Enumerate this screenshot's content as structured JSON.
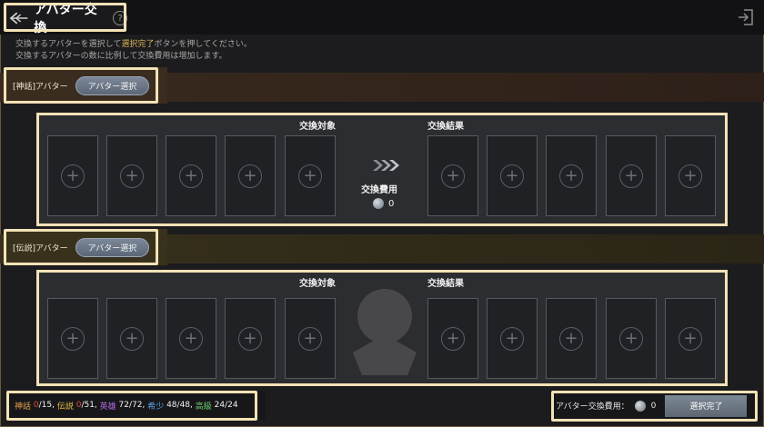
{
  "header": {
    "title": "アバター交換",
    "help": "?"
  },
  "info": {
    "line1_pre": "交換するアバターを選択して",
    "line1_highlight": "選択完了",
    "line1_post": "ボタンを押してください。",
    "line2": "交換するアバターの数に比例して交換費用は増加します。"
  },
  "sections": [
    {
      "label": "[神話]アバター",
      "select_button": "アバター選択",
      "target_title": "交換対象",
      "result_title": "交換結果",
      "cost_label": "交換費用",
      "cost_value": "0"
    },
    {
      "label": "[伝説]アバター",
      "select_button": "アバター選択",
      "target_title": "交換対象",
      "result_title": "交換結果"
    }
  ],
  "counts": [
    {
      "name": "神話",
      "current": "0",
      "max": "/15,",
      "name_color": "#e8a04a",
      "cur_color": "#e04a3a"
    },
    {
      "name": "伝説",
      "current": "0",
      "max": "/51,",
      "name_color": "#e8c04a",
      "cur_color": "#e04a3a"
    },
    {
      "name": "英雄",
      "current": "72",
      "max": "/72,",
      "name_color": "#b06ae0",
      "cur_color": "#f0f0f0"
    },
    {
      "name": "希少",
      "current": "48",
      "max": "/48,",
      "name_color": "#5aa0e8",
      "cur_color": "#f0f0f0"
    },
    {
      "name": "高級",
      "current": "24",
      "max": "/24",
      "name_color": "#6ac86a",
      "cur_color": "#f0f0f0"
    }
  ],
  "footer": {
    "total_cost_label": "アバター交換費用：",
    "total_cost_value": "0",
    "complete_button": "選択完了"
  },
  "icons": {
    "back": "back-arrow-icon",
    "help": "help-icon",
    "exit": "exit-icon",
    "add": "plus-icon",
    "arrow": "triple-chevron-icon",
    "coin": "coin-icon"
  }
}
